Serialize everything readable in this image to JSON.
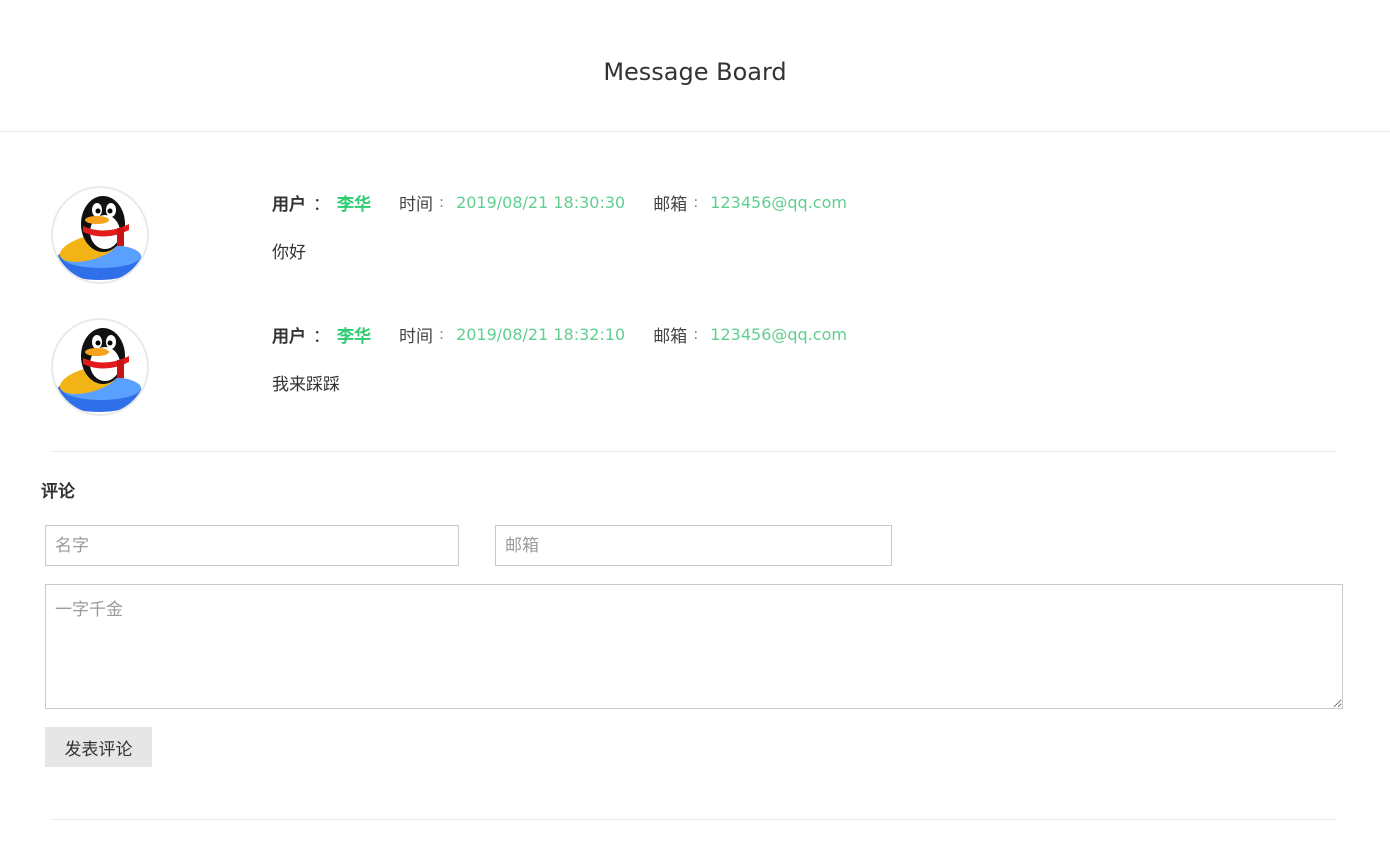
{
  "header": {
    "title": "Message Board"
  },
  "comments": [
    {
      "user_label": "用户",
      "colon": "：",
      "username": "李华",
      "time_label": "时间",
      "time_colon": ":",
      "time": "2019/08/21 18:30:30",
      "email_label": "邮箱",
      "email_colon": ":",
      "email": "123456@qq.com",
      "message": "你好",
      "avatar_icon": "qq-penguin-avatar"
    },
    {
      "user_label": "用户",
      "colon": "：",
      "username": "李华",
      "time_label": "时间",
      "time_colon": ":",
      "time": "2019/08/21 18:32:10",
      "email_label": "邮箱",
      "email_colon": ":",
      "email": "123456@qq.com",
      "message": "我来踩踩",
      "avatar_icon": "qq-penguin-avatar"
    }
  ],
  "form": {
    "section_title": "评论",
    "name_placeholder": "名字",
    "name_value": "",
    "email_placeholder": "邮箱",
    "email_value": "",
    "content_placeholder": "一字千金",
    "content_value": "",
    "submit_label": "发表评论"
  },
  "colors": {
    "accent_green": "#2ecc71",
    "meta_value_green": "#5fcf8f",
    "divider": "#ebebeb",
    "button_bg": "#e6e6e6"
  }
}
